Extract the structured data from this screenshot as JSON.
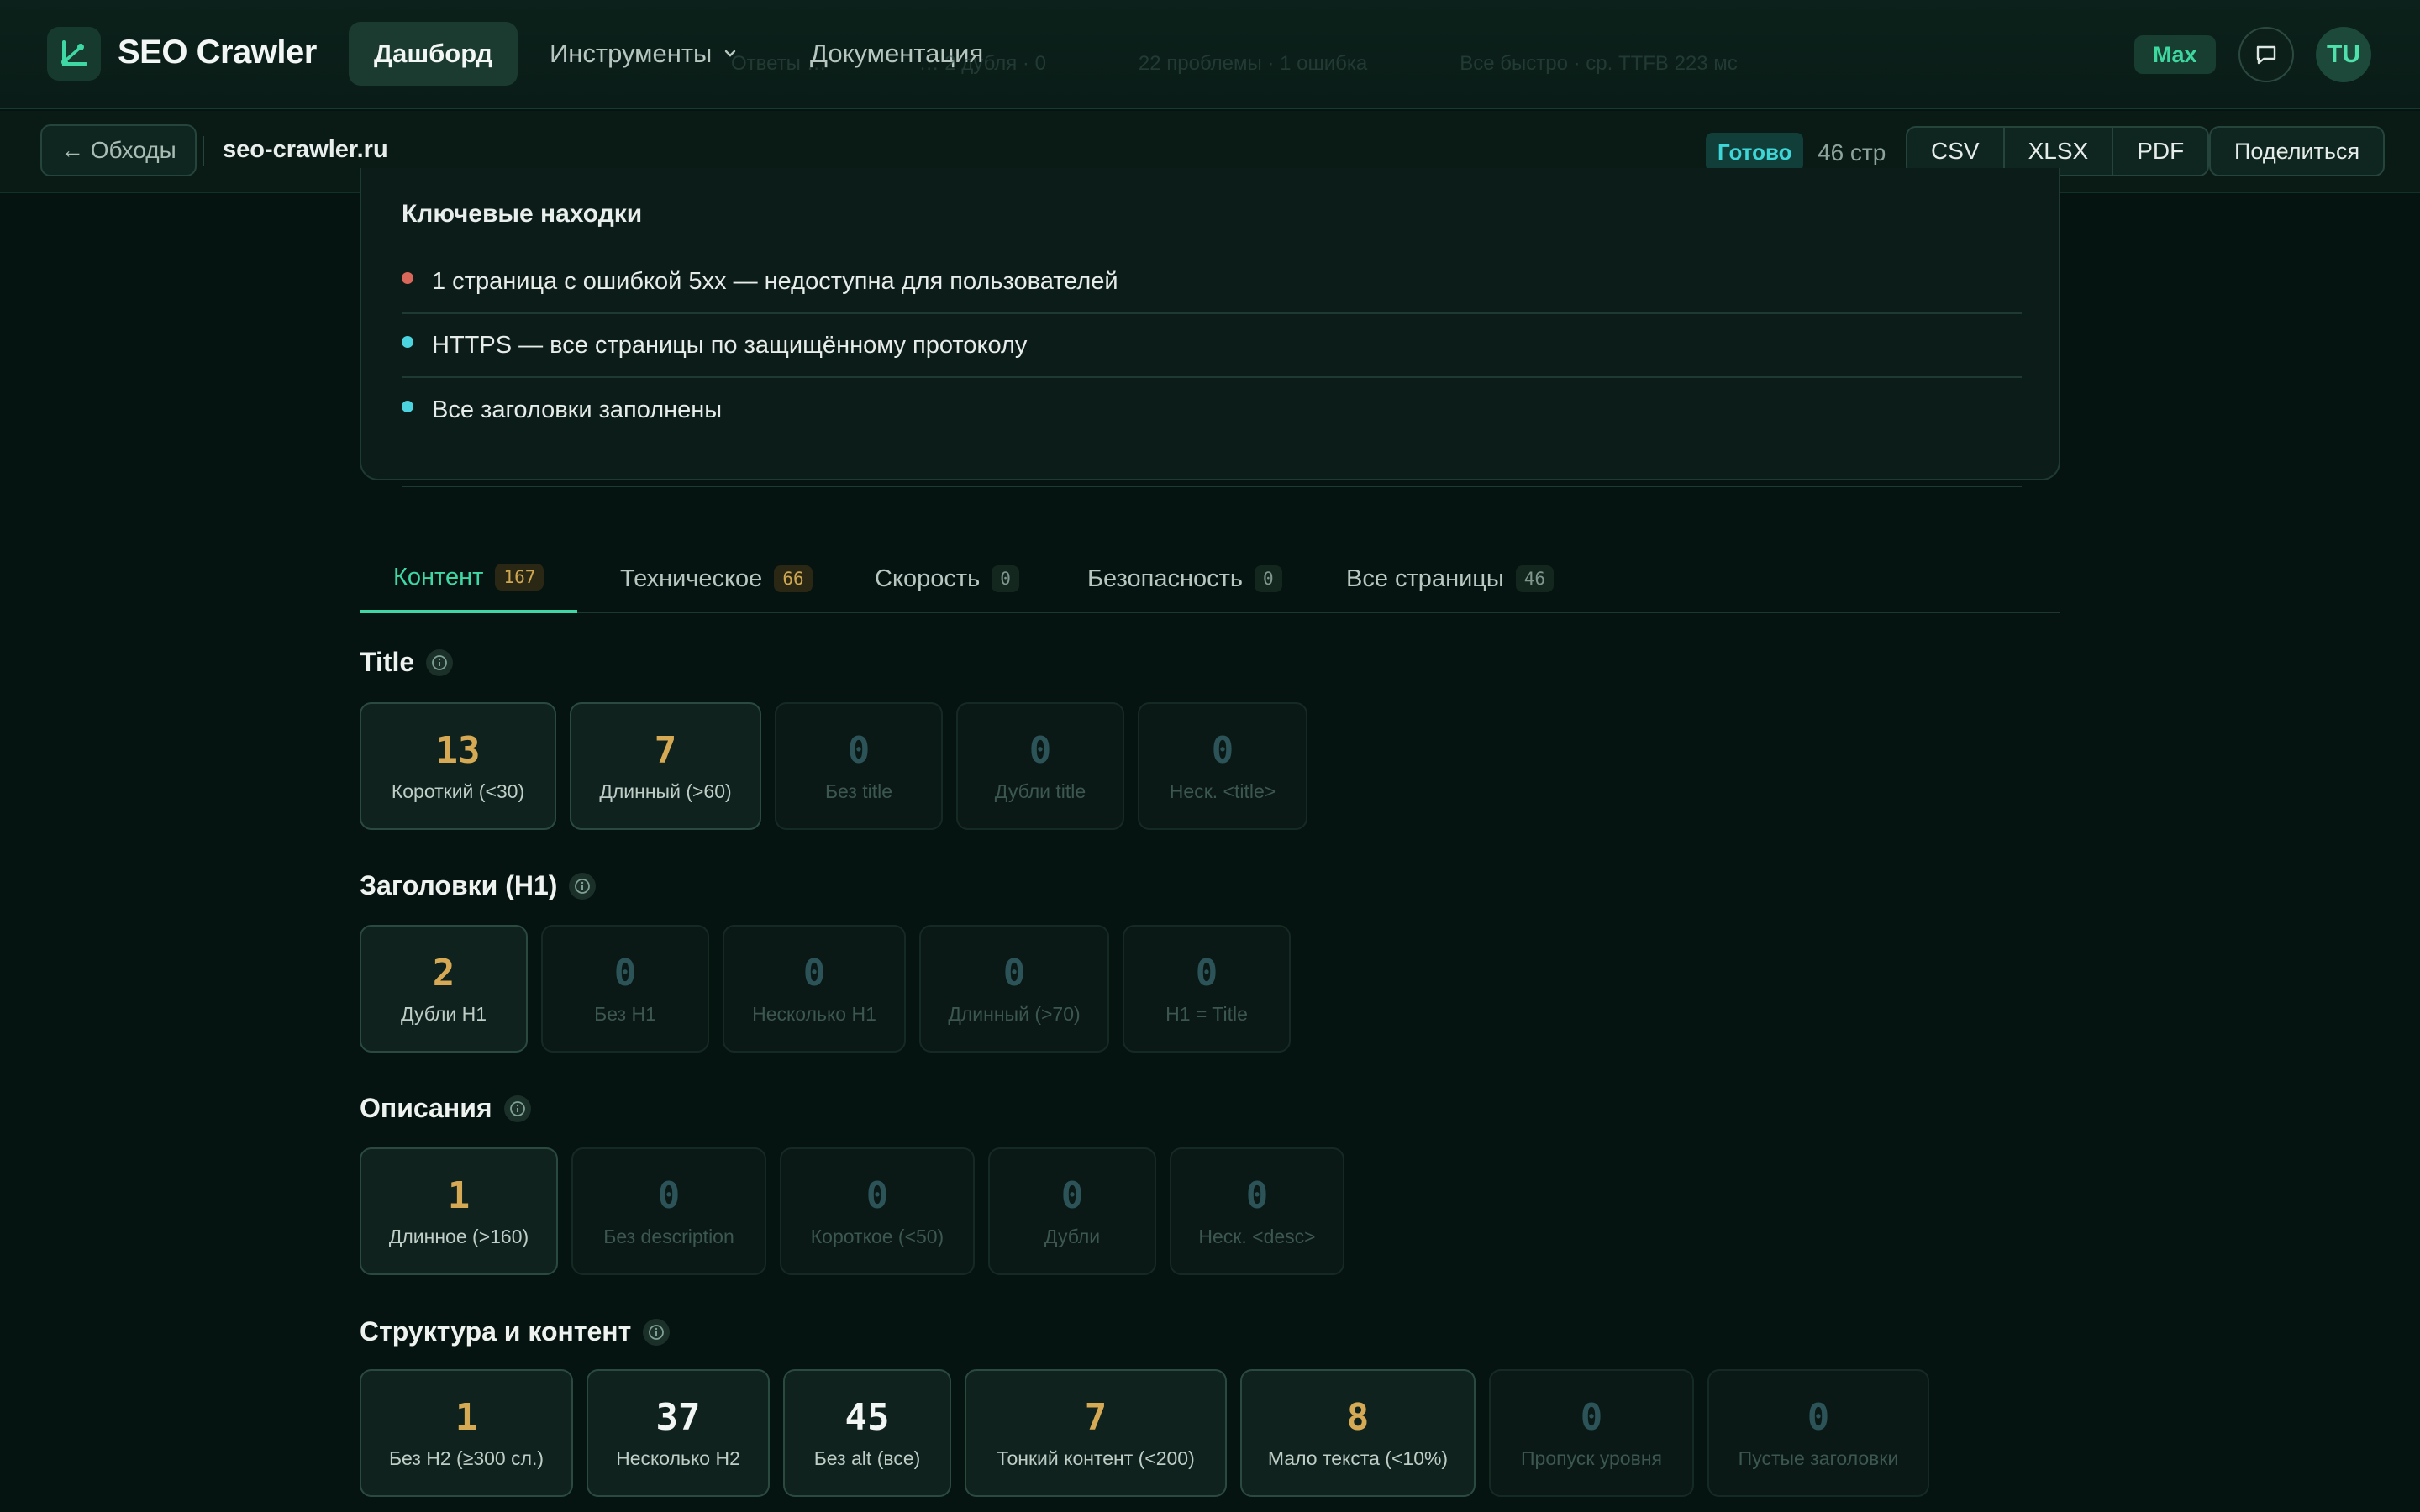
{
  "header": {
    "brand": "SEO Crawler",
    "nav": [
      {
        "label": "Дашборд"
      },
      {
        "label": "Инструменты"
      },
      {
        "label": "Документация"
      }
    ],
    "ghost_stats": [
      "Ответы …",
      "… 2 дубля · 0",
      "22 проблемы · 1 ошибка",
      "Все быстро · ср. TTFB 223 мс"
    ],
    "plan": "Max",
    "avatar": "TU"
  },
  "subbar": {
    "back": "← Обходы",
    "domain": "seo-crawler.ru",
    "status": "Готово",
    "pages": "46 стр",
    "exports": [
      "CSV",
      "XLSX",
      "PDF"
    ],
    "share": "Поделиться"
  },
  "findings": {
    "title": "Ключевые находки",
    "items": [
      {
        "text": "1 страница с ошибкой 5xx — недоступна для пользователей",
        "color": "#d9675a"
      },
      {
        "text": "HTTPS — все страницы по защищённому протоколу",
        "color": "#4cd3e0"
      },
      {
        "text": "Все заголовки заполнены",
        "color": "#4cd3e0"
      }
    ]
  },
  "tabs": [
    {
      "label": "Контент",
      "count": "167"
    },
    {
      "label": "Техническое",
      "count": "66"
    },
    {
      "label": "Скорость",
      "count": "0"
    },
    {
      "label": "Безопасность",
      "count": "0"
    },
    {
      "label": "Все страницы",
      "count": "46"
    }
  ],
  "sections": {
    "title": {
      "heading": "Title",
      "cards": [
        {
          "value": "13",
          "label": "Короткий (<30)"
        },
        {
          "value": "7",
          "label": "Длинный (>60)"
        },
        {
          "value": "0",
          "label": "Без title"
        },
        {
          "value": "0",
          "label": "Дубли title"
        },
        {
          "value": "0",
          "label": "Неск. <title>"
        }
      ]
    },
    "h1": {
      "heading": "Заголовки (H1)",
      "cards": [
        {
          "value": "2",
          "label": "Дубли H1"
        },
        {
          "value": "0",
          "label": "Без H1"
        },
        {
          "value": "0",
          "label": "Несколько H1"
        },
        {
          "value": "0",
          "label": "Длинный (>70)"
        },
        {
          "value": "0",
          "label": "H1 = Title"
        }
      ]
    },
    "desc": {
      "heading": "Описания",
      "cards": [
        {
          "value": "1",
          "label": "Длинное (>160)"
        },
        {
          "value": "0",
          "label": "Без description"
        },
        {
          "value": "0",
          "label": "Короткое (<50)"
        },
        {
          "value": "0",
          "label": "Дубли"
        },
        {
          "value": "0",
          "label": "Неск. <desc>"
        }
      ]
    },
    "structure": {
      "heading": "Структура и контент",
      "cards": [
        {
          "value": "1",
          "label": "Без H2 (≥300 сл.)"
        },
        {
          "value": "37",
          "label": "Несколько H2"
        },
        {
          "value": "45",
          "label": "Без alt (все)"
        },
        {
          "value": "7",
          "label": "Тонкий контент (<200)"
        },
        {
          "value": "8",
          "label": "Мало текста (<10%)"
        },
        {
          "value": "0",
          "label": "Пропуск уровня"
        },
        {
          "value": "0",
          "label": "Пустые заголовки"
        }
      ]
    }
  }
}
